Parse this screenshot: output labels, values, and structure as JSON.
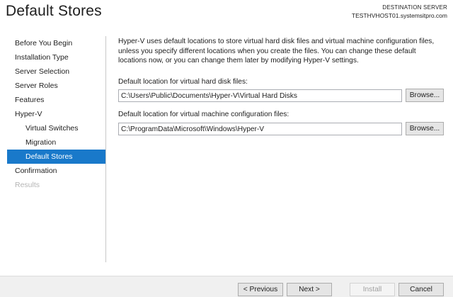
{
  "header": {
    "title": "Default Stores",
    "destination_label": "DESTINATION SERVER",
    "destination_server": "TESTHVHOST01.systemsitpro.com"
  },
  "sidebar": {
    "items": [
      {
        "label": "Before You Begin",
        "level": 0,
        "state": "normal"
      },
      {
        "label": "Installation Type",
        "level": 0,
        "state": "normal"
      },
      {
        "label": "Server Selection",
        "level": 0,
        "state": "normal"
      },
      {
        "label": "Server Roles",
        "level": 0,
        "state": "normal"
      },
      {
        "label": "Features",
        "level": 0,
        "state": "normal"
      },
      {
        "label": "Hyper-V",
        "level": 0,
        "state": "normal"
      },
      {
        "label": "Virtual Switches",
        "level": 1,
        "state": "normal"
      },
      {
        "label": "Migration",
        "level": 1,
        "state": "normal"
      },
      {
        "label": "Default Stores",
        "level": 1,
        "state": "active"
      },
      {
        "label": "Confirmation",
        "level": 0,
        "state": "normal"
      },
      {
        "label": "Results",
        "level": 0,
        "state": "disabled"
      }
    ]
  },
  "main": {
    "description": "Hyper-V uses default locations to store virtual hard disk files and virtual machine configuration files, unless you specify different locations when you create the files. You can change these default locations now, or you can change them later by modifying Hyper-V settings.",
    "vhd": {
      "label": "Default location for virtual hard disk files:",
      "value": "C:\\Users\\Public\\Documents\\Hyper-V\\Virtual Hard Disks",
      "browse_label": "Browse..."
    },
    "vm_config": {
      "label": "Default location for virtual machine configuration files:",
      "value": "C:\\ProgramData\\Microsoft\\Windows\\Hyper-V",
      "browse_label": "Browse..."
    }
  },
  "footer": {
    "previous_label": "< Previous",
    "next_label": "Next >",
    "install_label": "Install",
    "cancel_label": "Cancel"
  },
  "colors": {
    "accent": "#1979ca",
    "disabled_text": "#b5b5b5"
  }
}
